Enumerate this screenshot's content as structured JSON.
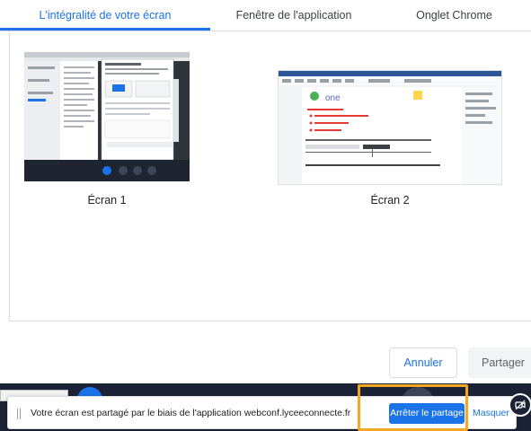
{
  "tabs": [
    {
      "label": "L'intégralité de votre écran",
      "active": true
    },
    {
      "label": "Fenêtre de l'application",
      "active": false
    },
    {
      "label": "Onglet Chrome",
      "active": false
    }
  ],
  "screens": [
    {
      "label": "Écran 1",
      "selected": false
    },
    {
      "label": "Écran 2",
      "selected": false
    }
  ],
  "screen2_preview": {
    "logo_text": "one",
    "bullets": [
      "",
      "",
      ""
    ]
  },
  "actions": {
    "cancel_label": "Annuler",
    "share_label": "Partager"
  },
  "share_bar": {
    "message": "Votre écran est partagé par le biais de l'application webconf.lyceeconnecte.fr",
    "stop_label": "Arrêter le partage",
    "hide_label": "Masquer"
  },
  "colors": {
    "accent": "#1a73e8",
    "highlight": "#f5a623",
    "bottom_bar": "#1b2236",
    "bullet_red": "#e53935"
  },
  "icons": [
    "grip-icon",
    "camera-off-icon"
  ]
}
